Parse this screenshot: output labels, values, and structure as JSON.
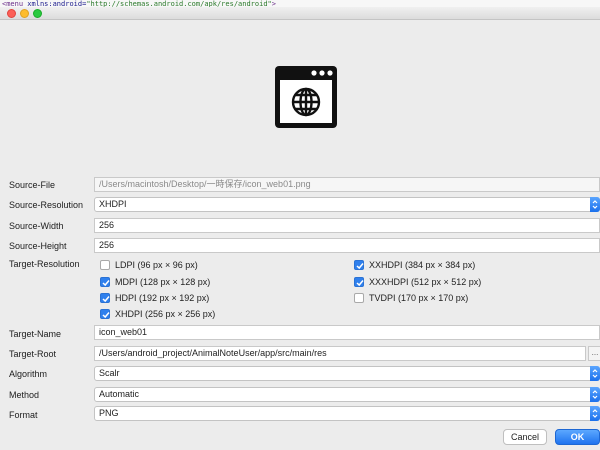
{
  "code_line": {
    "tag": "<menu ",
    "attr": "xmlns:android=",
    "value": "\"http://schemas.android.com/apk/res/android\"",
    "end": ">"
  },
  "preview": {
    "icon": "browser-window-globe-icon"
  },
  "form": {
    "source_file": {
      "label": "Source-File",
      "value": "/Users/macintosh/Desktop/一時保存/icon_web01.png"
    },
    "source_resolution": {
      "label": "Source-Resolution",
      "value": "XHDPI"
    },
    "source_width": {
      "label": "Source-Width",
      "value": "256"
    },
    "source_height": {
      "label": "Source-Height",
      "value": "256"
    },
    "target_resolution": {
      "label": "Target-Resolution",
      "options": [
        {
          "label": "LDPI (96 px × 96 px)",
          "checked": false
        },
        {
          "label": "MDPI (128 px × 128 px)",
          "checked": true
        },
        {
          "label": "HDPI (192 px × 192 px)",
          "checked": true
        },
        {
          "label": "XHDPI (256 px × 256 px)",
          "checked": true
        },
        {
          "label": "XXHDPI (384 px × 384 px)",
          "checked": true
        },
        {
          "label": "XXXHDPI (512 px × 512 px)",
          "checked": true
        },
        {
          "label": "TVDPI (170 px × 170 px)",
          "checked": false
        }
      ]
    },
    "target_name": {
      "label": "Target-Name",
      "value": "icon_web01"
    },
    "target_root": {
      "label": "Target-Root",
      "value": "/Users/android_project/AnimalNoteUser/app/src/main/res",
      "browse_label": "..."
    },
    "algorithm": {
      "label": "Algorithm",
      "value": "Scalr"
    },
    "method": {
      "label": "Method",
      "value": "Automatic"
    },
    "format": {
      "label": "Format",
      "value": "PNG"
    }
  },
  "buttons": {
    "cancel": "Cancel",
    "ok": "OK"
  },
  "colors": {
    "accent": "#2f80ed",
    "ok_button": "#1f73ef"
  }
}
